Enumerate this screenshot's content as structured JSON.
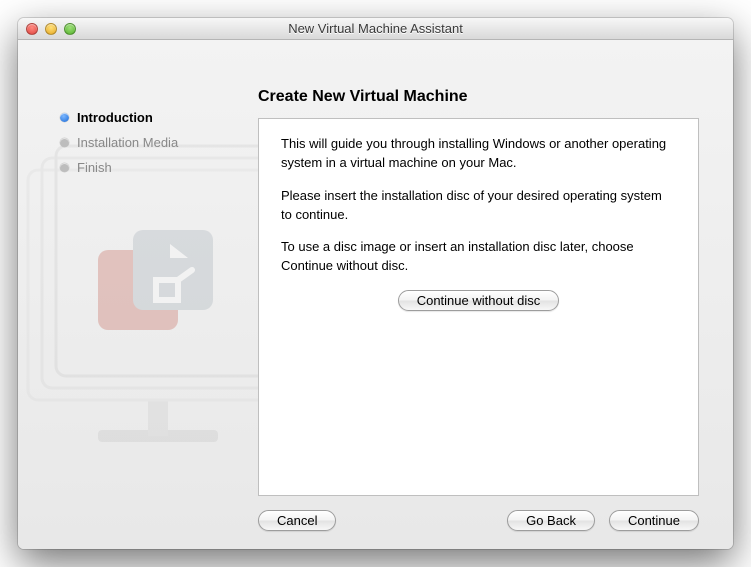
{
  "window": {
    "title": "New Virtual Machine Assistant"
  },
  "sidebar": {
    "steps": [
      {
        "label": "Introduction",
        "active": true
      },
      {
        "label": "Installation Media",
        "active": false
      },
      {
        "label": "Finish",
        "active": false
      }
    ]
  },
  "main": {
    "heading": "Create New Virtual Machine",
    "intro": "This will guide you through installing Windows or another operating system in a virtual machine on your Mac.",
    "instruction1": "Please insert the installation disc of your desired operating system to continue.",
    "instruction2": "To use a disc image or insert an installation disc later, choose Continue without disc.",
    "continue_without_disc": "Continue without disc"
  },
  "footer": {
    "cancel": "Cancel",
    "go_back": "Go Back",
    "continue": "Continue"
  }
}
